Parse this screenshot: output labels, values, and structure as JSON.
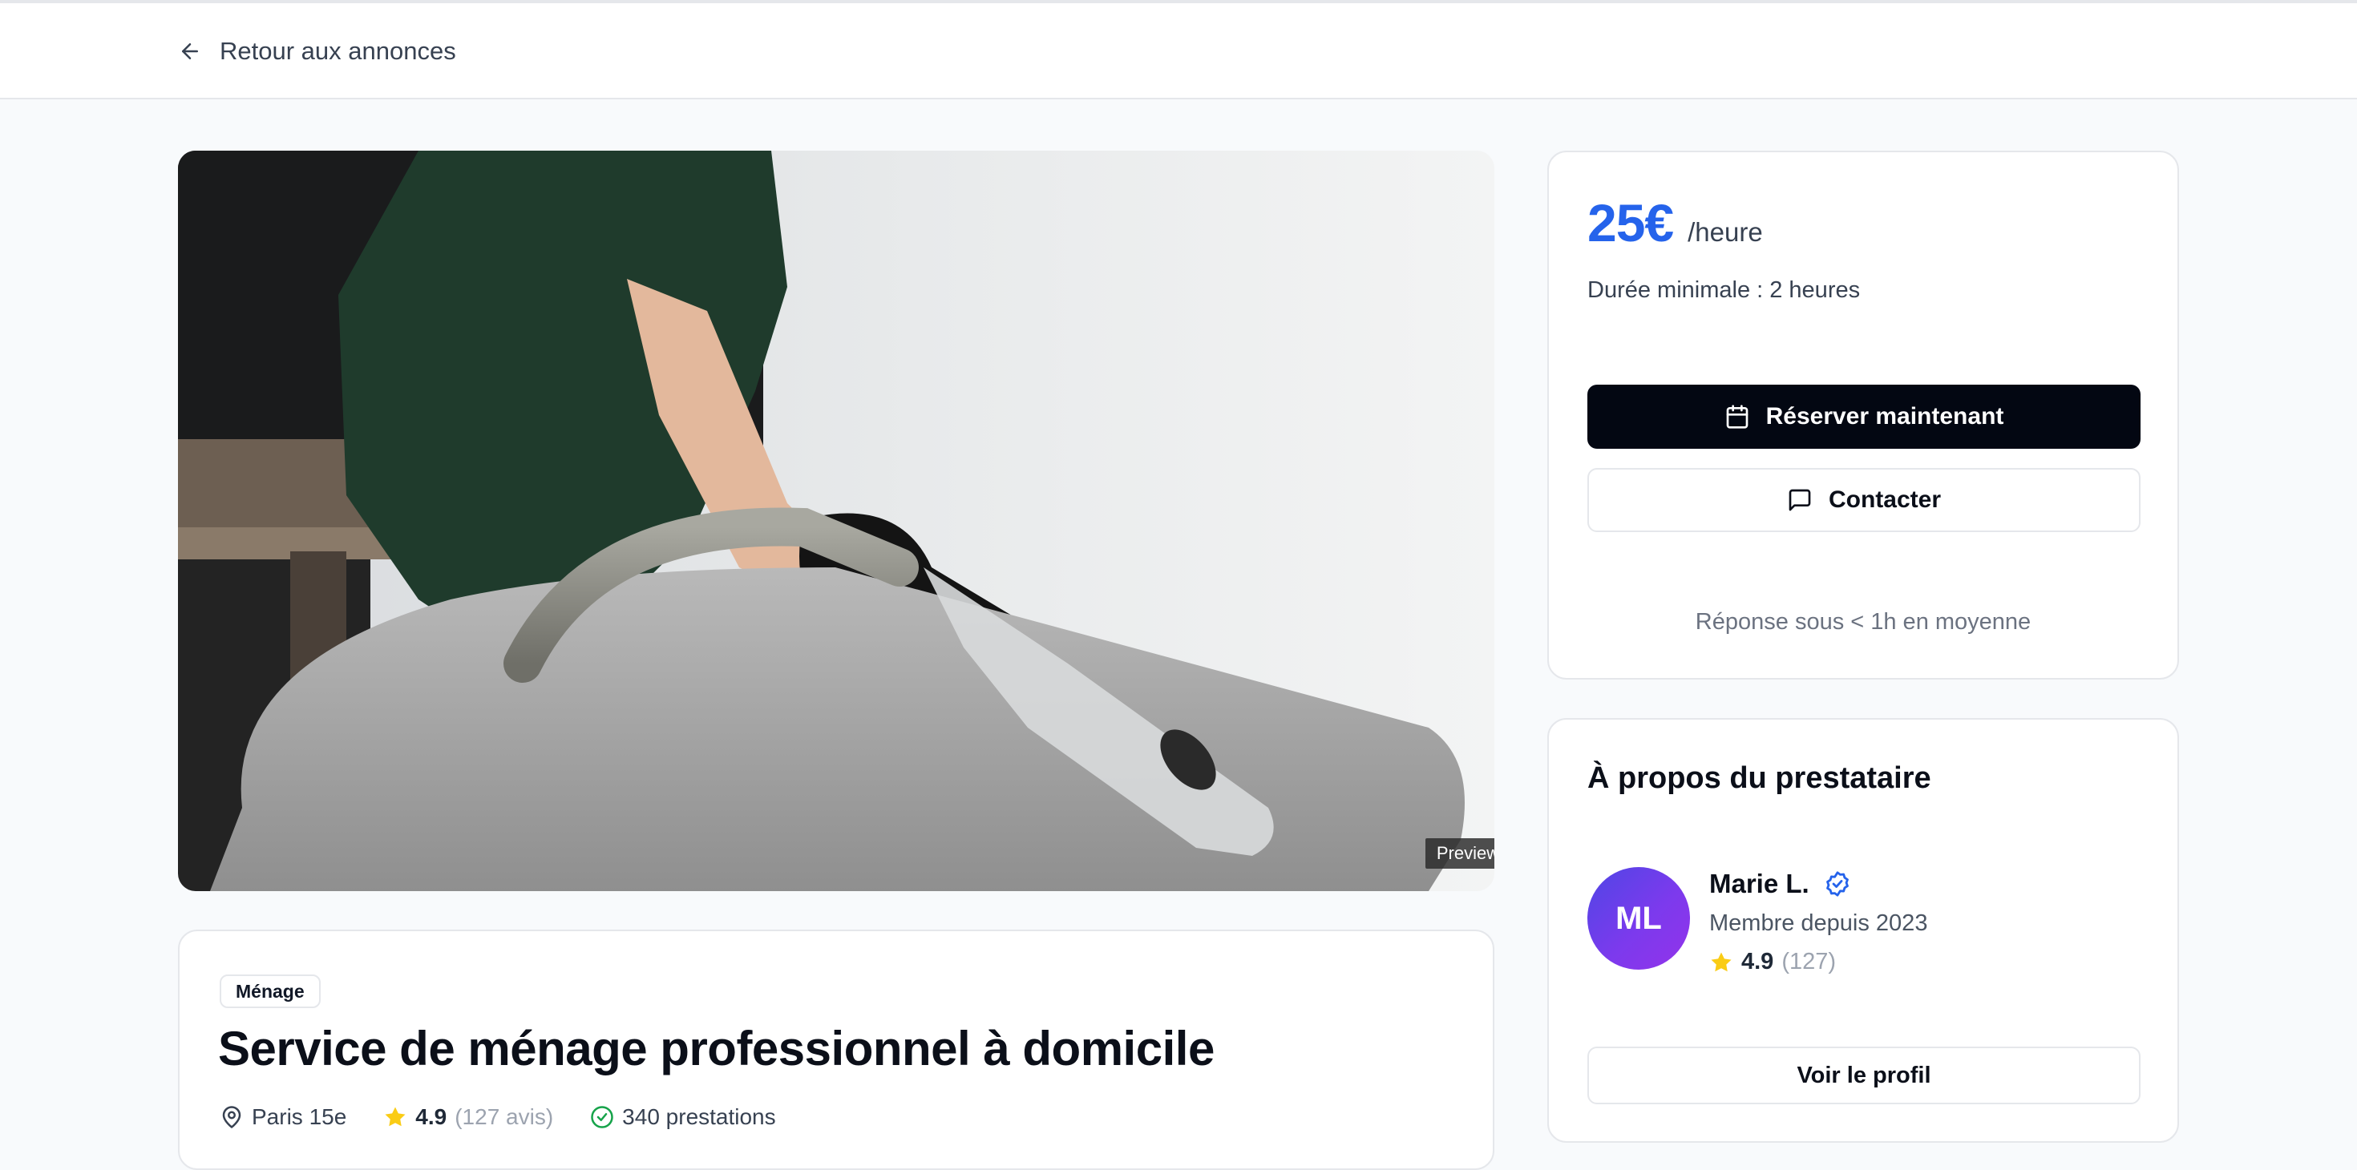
{
  "header": {
    "back_label": "Retour aux annonces"
  },
  "hero": {
    "preview_label": "Preview"
  },
  "listing": {
    "category": "Ménage",
    "title": "Service de ménage professionnel à domicile",
    "location": "Paris 15e",
    "rating": "4.9",
    "reviews": "(127 avis)",
    "jobs": "340 prestations"
  },
  "pricing": {
    "price": "25€",
    "unit": "/heure",
    "min_duration": "Durée minimale : 2 heures",
    "book_label": "Réserver maintenant",
    "contact_label": "Contacter",
    "response_time": "Réponse sous < 1h en moyenne"
  },
  "provider": {
    "section_title": "À propos du prestataire",
    "initials": "ML",
    "name": "Marie L.",
    "member_since": "Membre depuis 2023",
    "rating": "4.9",
    "review_count": "(127)",
    "profile_label": "Voir le profil"
  },
  "colors": {
    "accent": "#2563eb",
    "primary_button": "#030712",
    "star": "#facc15",
    "success": "#16a34a"
  },
  "icons": [
    "arrow-left-icon",
    "map-pin-icon",
    "star-icon",
    "check-circle-icon",
    "calendar-icon",
    "message-square-icon",
    "verified-badge-icon"
  ]
}
